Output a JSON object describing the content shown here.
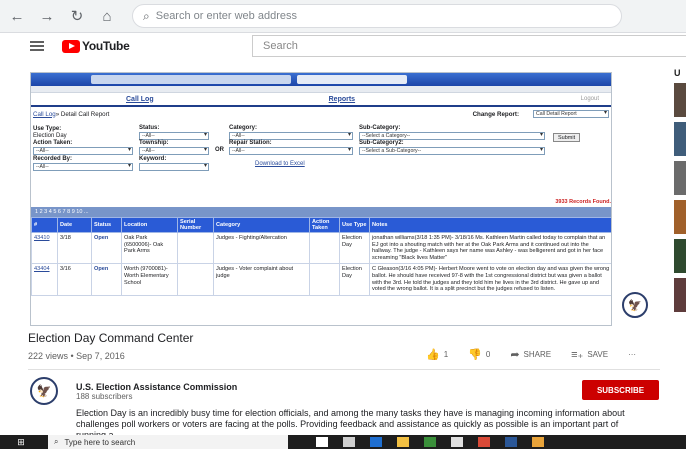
{
  "browser": {
    "address_placeholder": "Search or enter web address",
    "back": "←",
    "forward": "→",
    "refresh": "↻",
    "home": "⌂"
  },
  "youtube": {
    "brand": "YouTube",
    "search_placeholder": "Search",
    "sidebar_label": "U"
  },
  "video": {
    "app_nav": {
      "call_log": "Call Log",
      "reports": "Reports",
      "logout": "Logout"
    },
    "breadcrumb_link": "Call Log",
    "breadcrumb_rest": " » Detail Call Report",
    "change_report_label": "Change Report:",
    "change_report_value": "Call Detail Report",
    "filters": {
      "use_type_label": "Use Type:",
      "use_type_value": "Election Day",
      "status_label": "Status:",
      "status_value": "--All--",
      "category_label": "Category:",
      "category_value": "--All--",
      "subcategory_label": "Sub-Category:",
      "subcategory_value": "--Select a Category--",
      "submit": "Submit",
      "action_taken_label": "Action Taken:",
      "action_taken_value": "--All--",
      "township_label": "Township:",
      "township_value": "--All--",
      "or": "OR",
      "repair_station_label": "Repair Station:",
      "repair_station_value": "--All--",
      "subcategory2_label": "Sub-Category2:",
      "subcategory2_value": "--Select a Sub-Category--",
      "recorded_by_label": "Recorded By:",
      "recorded_by_value": "--All--",
      "keyword_label": "Keyword:",
      "download": "Download to Excel"
    },
    "records_found": "3933 Records Found.",
    "pager": "1 2 3 4 5 6 7 8 9 10 ...",
    "table": {
      "headers": [
        "#",
        "Date",
        "Status",
        "Location",
        "Serial Number",
        "Category",
        "Action Taken",
        "Use Type",
        "Notes"
      ],
      "rows": [
        {
          "id": "43410",
          "date": "3/18",
          "status": "Open",
          "location": "Oak Park (6500006)- Oak Park Arms",
          "serial": "",
          "category": "Judges - Fighting/Altercation",
          "action": "",
          "use_type": "Election Day",
          "notes": "jonathan williams(3/18 1:35 PM)- 3/18/16 Ms. Kathleen Martin called today to complain that an EJ got into a shouting match with her at the Oak Park Arms and it continued out into the hallway. The judge - Kathleen says her name was Ashley - was belligerent and got in her face screaming \"Black lives Matter\""
        },
        {
          "id": "43404",
          "date": "3/16",
          "status": "Open",
          "location": "Worth (9700081)- Worth Elementary School",
          "serial": "",
          "category": "Judges - Voter complaint about judge",
          "action": "",
          "use_type": "Election Day",
          "notes": "C Gleason(3/16 4:05 PM)- Herbert Moore went to vote on election day and was given the wrong ballot. He should have received 97-8 with the 1st congressional district but was given a ballot with the 3rd. He told the judges and they told him he lives in the 3rd district. He gave up and voted the wrong ballot. It is a split precinct but the judges refused to listen."
        }
      ]
    }
  },
  "details": {
    "title": "Election Day Command Center",
    "meta": "222 views • Sep 7, 2016",
    "likes": "1",
    "dislikes": "0",
    "share": "SHARE",
    "save": "SAVE",
    "more": "···",
    "channel_name": "U.S. Election Assistance Commission",
    "subscribers": "188 subscribers",
    "subscribe": "SUBSCRIBE",
    "description": "Election Day is an incredibly busy time for election officials, and among the many tasks they have is managing incoming information about challenges poll workers or voters are facing at the polls. Providing feedback and assistance as quickly as possible is an important part of running a"
  },
  "taskbar": {
    "search_placeholder": "Type here to search"
  },
  "colors": {
    "youtube_red": "#ff0000",
    "subscribe_red": "#cc0000",
    "table_header": "#2a5bd6"
  }
}
